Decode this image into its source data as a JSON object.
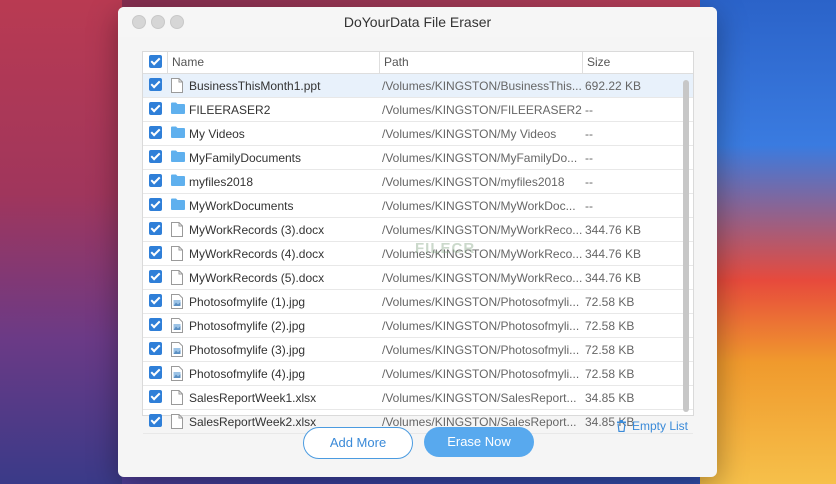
{
  "window": {
    "title": "DoYourData File Eraser"
  },
  "table": {
    "headers": {
      "name": "Name",
      "path": "Path",
      "size": "Size"
    },
    "rows": [
      {
        "name": "BusinessThisMonth1.ppt",
        "path": "/Volumes/KINGSTON/BusinessThis...",
        "size": "692.22 KB",
        "icon": "document-icon",
        "checked": true
      },
      {
        "name": "FILEERASER2",
        "path": "/Volumes/KINGSTON/FILEERASER2",
        "size": "--",
        "icon": "folder-icon",
        "checked": true
      },
      {
        "name": "My Videos",
        "path": "/Volumes/KINGSTON/My Videos",
        "size": "--",
        "icon": "folder-icon",
        "checked": true
      },
      {
        "name": "MyFamilyDocuments",
        "path": "/Volumes/KINGSTON/MyFamilyDo...",
        "size": "--",
        "icon": "folder-icon",
        "checked": true
      },
      {
        "name": "myfiles2018",
        "path": "/Volumes/KINGSTON/myfiles2018",
        "size": "--",
        "icon": "folder-icon",
        "checked": true
      },
      {
        "name": "MyWorkDocuments",
        "path": "/Volumes/KINGSTON/MyWorkDoc...",
        "size": "--",
        "icon": "folder-icon",
        "checked": true
      },
      {
        "name": "MyWorkRecords (3).docx",
        "path": "/Volumes/KINGSTON/MyWorkReco...",
        "size": "344.76 KB",
        "icon": "document-icon",
        "checked": true
      },
      {
        "name": "MyWorkRecords (4).docx",
        "path": "/Volumes/KINGSTON/MyWorkReco...",
        "size": "344.76 KB",
        "icon": "document-icon",
        "checked": true
      },
      {
        "name": "MyWorkRecords (5).docx",
        "path": "/Volumes/KINGSTON/MyWorkReco...",
        "size": "344.76 KB",
        "icon": "document-icon",
        "checked": true
      },
      {
        "name": "Photosofmylife (1).jpg",
        "path": "/Volumes/KINGSTON/Photosofmyli...",
        "size": "72.58 KB",
        "icon": "image-icon",
        "checked": true
      },
      {
        "name": "Photosofmylife (2).jpg",
        "path": "/Volumes/KINGSTON/Photosofmyli...",
        "size": "72.58 KB",
        "icon": "image-icon",
        "checked": true
      },
      {
        "name": "Photosofmylife (3).jpg",
        "path": "/Volumes/KINGSTON/Photosofmyli...",
        "size": "72.58 KB",
        "icon": "image-icon",
        "checked": true
      },
      {
        "name": "Photosofmylife (4).jpg",
        "path": "/Volumes/KINGSTON/Photosofmyli...",
        "size": "72.58 KB",
        "icon": "image-icon",
        "checked": true
      },
      {
        "name": "SalesReportWeek1.xlsx",
        "path": "/Volumes/KINGSTON/SalesReport...",
        "size": "34.85 KB",
        "icon": "document-icon",
        "checked": true
      },
      {
        "name": "SalesReportWeek2.xlsx",
        "path": "/Volumes/KINGSTON/SalesReport...",
        "size": "34.85 KB",
        "icon": "document-icon",
        "checked": true
      }
    ]
  },
  "watermark": "FILECR",
  "buttons": {
    "add_more": "Add More",
    "erase_now": "Erase Now",
    "empty_list": "Empty List"
  },
  "colors": {
    "accent": "#2f7fd8",
    "button": "#58a9ee",
    "folder": "#5fb0ee"
  }
}
